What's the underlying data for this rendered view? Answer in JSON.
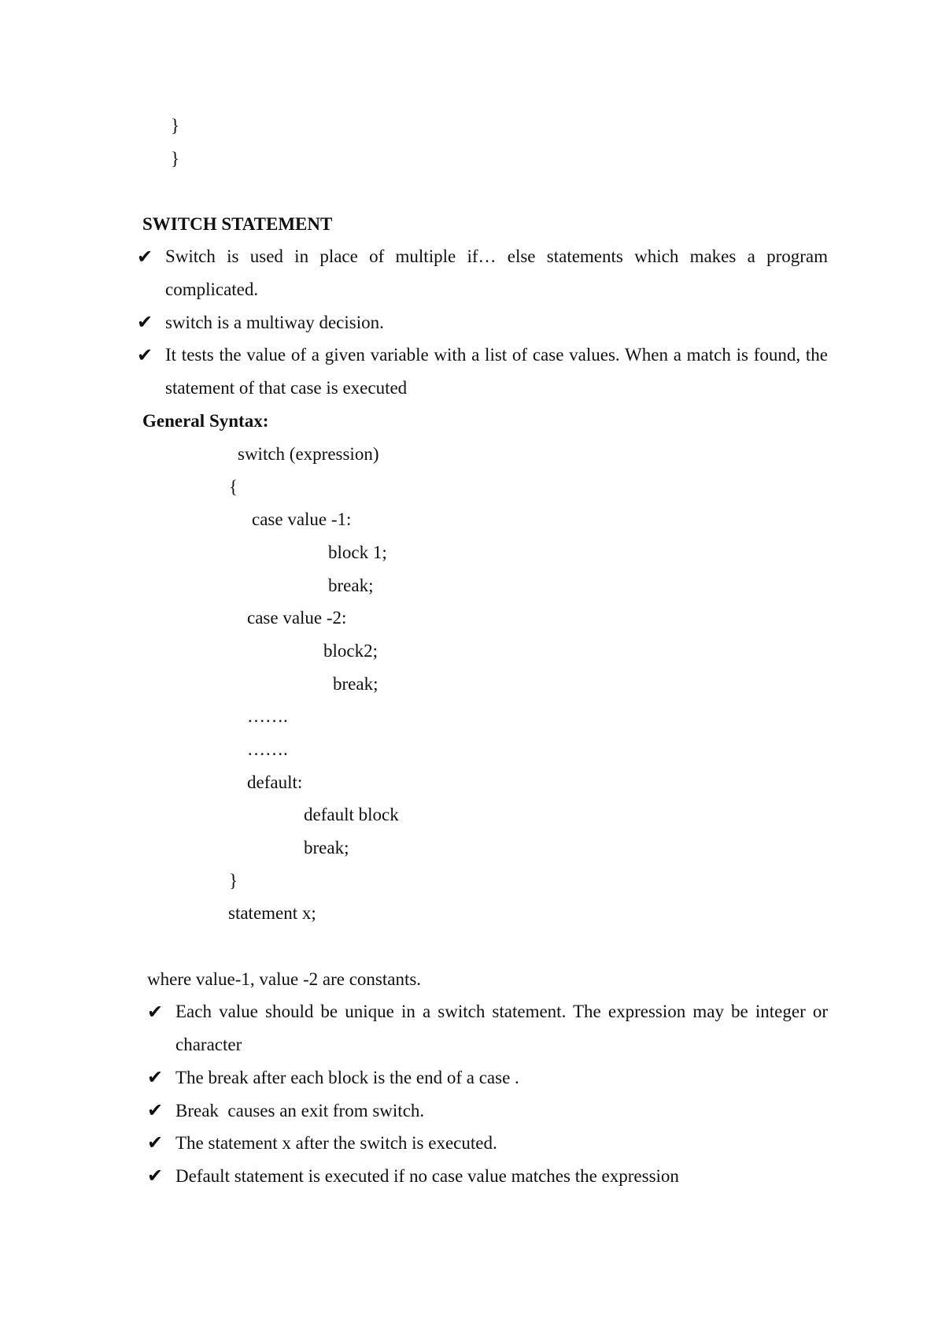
{
  "top_braces": [
    "}",
    "}"
  ],
  "section_heading": "SWITCH STATEMENT",
  "intro_bullets": [
    "Switch is used in place of multiple if… else statements which makes a program complicated.",
    "switch is a multiway decision.",
    "It tests the value of a given variable with a list of case values. When a match is found, the statement of that case is executed"
  ],
  "syntax_heading": "General Syntax:",
  "code_lines": [
    "switch (expression)",
    "{",
    "case value -1:",
    "block 1;",
    "break;",
    "case value -2:",
    "block2;",
    "break;",
    "…….",
    "…….",
    "default:",
    "default block",
    "break;",
    "}",
    "statement x;"
  ],
  "where_line": "where value-1, value -2  are constants.",
  "notes_bullets": [
    "Each value should be unique in a switch statement. The expression may be integer or character",
    "The break after each block is the end of a case .",
    "Break  causes an exit from switch.",
    "The statement x after the switch is executed.",
    "Default statement is executed if no case value matches the expression"
  ],
  "check_glyph": "✔"
}
